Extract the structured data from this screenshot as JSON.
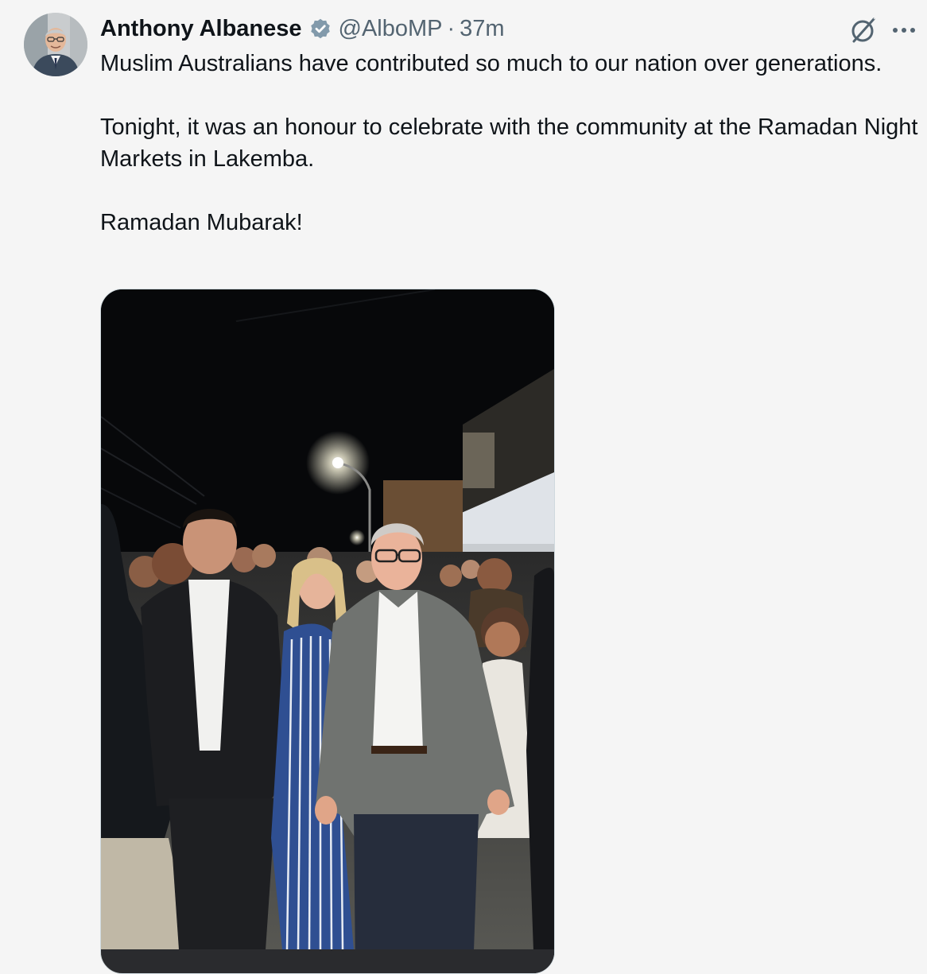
{
  "tweet": {
    "display_name": "Anthony Albanese",
    "handle": "@AlboMP",
    "separator": "·",
    "time": "37m",
    "text": {
      "p1": "Muslim Australians have contributed so much to our nation over generations.",
      "p2": "Tonight, it was an honour to celebrate with the community at the Ramadan Night Markets in Lakemba.",
      "p3": "Ramadan Mubarak!"
    },
    "icons": {
      "verified": "verified-badge-icon",
      "grok": "grok-icon",
      "more": "more-icon"
    },
    "colors": {
      "text": "#0f1419",
      "secondary": "#536471",
      "badge": "#829aab",
      "background": "#f5f5f5"
    }
  }
}
